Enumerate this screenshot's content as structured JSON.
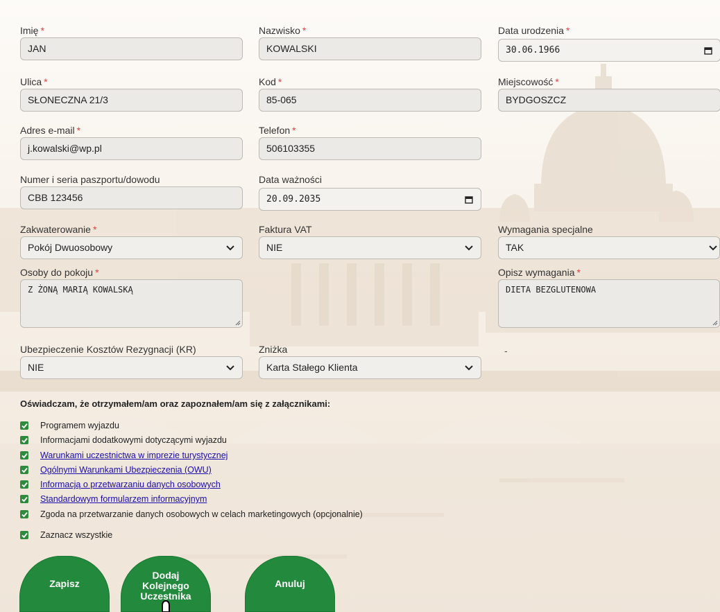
{
  "colors": {
    "accent_green": "#238a3d",
    "required_star": "#e04040",
    "link_blue": "#1a0dab"
  },
  "fields": {
    "imie": {
      "label": "Imię",
      "value": "JAN",
      "required": "*"
    },
    "nazwisko": {
      "label": "Nazwisko",
      "value": "KOWALSKI",
      "required": "*"
    },
    "data_urodzenia": {
      "label": "Data urodzenia",
      "value": "30.06.1966",
      "required": "*",
      "icon": "calendar-icon"
    },
    "ulica": {
      "label": "Ulica",
      "value": "SŁONECZNA 21/3",
      "required": "*"
    },
    "kod": {
      "label": "Kod",
      "value": "85-065",
      "required": "*"
    },
    "miejscowosc": {
      "label": "Miejscowość",
      "value": "BYDGOSZCZ",
      "required": "*"
    },
    "email": {
      "label": "Adres e-mail",
      "value": "j.kowalski@wp.pl",
      "required": "*"
    },
    "telefon": {
      "label": "Telefon",
      "value": "506103355",
      "required": "*"
    },
    "paszport": {
      "label": "Numer i seria paszportu/dowodu",
      "value": "CBB 123456"
    },
    "data_waznosci": {
      "label": "Data ważności",
      "value": "20.09.2035",
      "icon": "calendar-icon"
    },
    "zakwaterowanie": {
      "label": "Zakwaterowanie",
      "value": "Pokój Dwuosobowy",
      "required": "*"
    },
    "faktura": {
      "label": "Faktura VAT",
      "value": "NIE"
    },
    "wymagania": {
      "label": "Wymagania specjalne",
      "value": "TAK"
    },
    "osoby": {
      "label": "Osoby do pokoju",
      "value": "Z ŻONĄ MARIĄ KOWALSKĄ",
      "required": "*"
    },
    "opisz": {
      "label": "Opisz wymagania",
      "value": "DIETA BEZGLUTENOWA",
      "required": "*"
    },
    "ubezpieczenie": {
      "label": "Ubezpieczenie Kosztów Rezygnacji (KR)",
      "value": "NIE"
    },
    "znizka": {
      "label": "Zniżka",
      "value": "Karta Stałego Klienta"
    },
    "dash": "-"
  },
  "declaration": "Oświadczam, że otrzymałem/am oraz zapoznałem/am się z załącznikami:",
  "checkboxes": [
    {
      "label": "Programem wyjazdu",
      "checked": true
    },
    {
      "label": "Informacjami dodatkowymi dotyczącymi wyjazdu",
      "checked": true
    },
    {
      "label": "Warunkami uczestnictwa w imprezie turystycznej",
      "checked": true
    },
    {
      "label": "Ogólnymi Warunkami Ubezpieczenia (OWU)",
      "checked": true
    },
    {
      "label": "Informacją o przetwarzaniu danych osobowych",
      "checked": true
    },
    {
      "label": "Standardowym formularzem informacyjnym",
      "checked": true
    },
    {
      "label": "Zgoda na przetwarzanie danych osobowych w celach marketingowych (opcjonalnie)",
      "checked": true
    }
  ],
  "select_all": {
    "label": "Zaznacz wszystkie",
    "checked": true
  },
  "buttons": {
    "save": "Zapisz",
    "add_line1": "Dodaj",
    "add_line2": "Kolejnego",
    "add_line3": "Uczestnika",
    "cancel": "Anuluj"
  }
}
